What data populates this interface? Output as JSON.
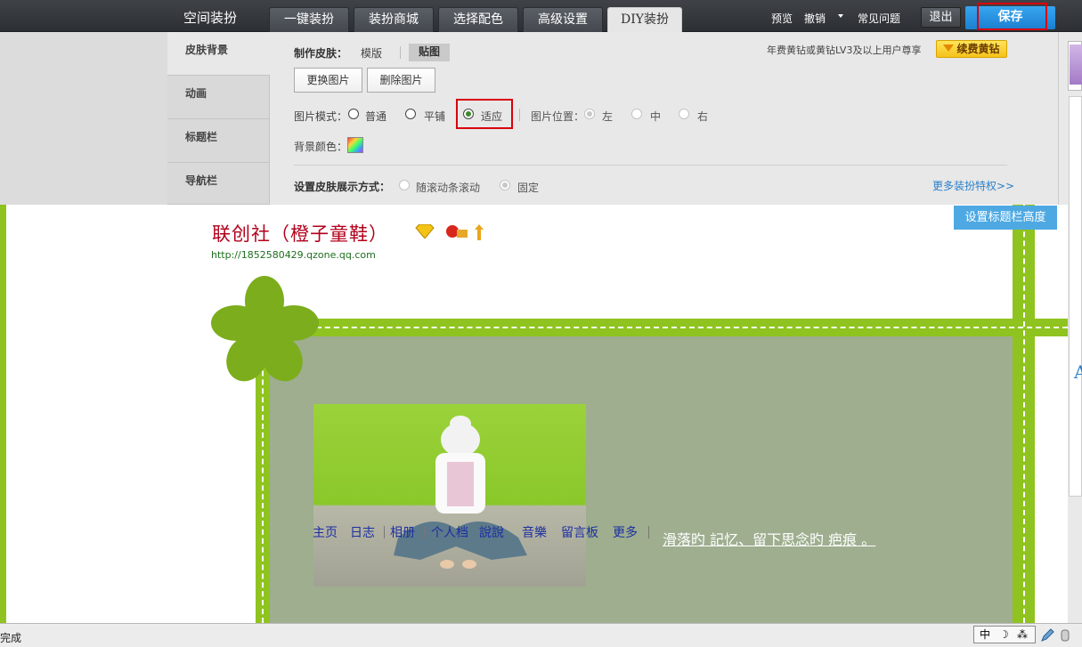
{
  "topbar": {
    "app_title": "空间装扮",
    "tabs": [
      {
        "label": "一键装扮"
      },
      {
        "label": "装扮商城"
      },
      {
        "label": "选择配色"
      },
      {
        "label": "高级设置"
      },
      {
        "label": "DIY装扮",
        "active": true
      }
    ],
    "links": {
      "preview": "预览",
      "undo": "撤销",
      "faq": "常见问题"
    },
    "exit_label": "退出",
    "save_label": "保存"
  },
  "sidebar": {
    "items": [
      {
        "label": "皮肤背景",
        "active": true
      },
      {
        "label": "动画"
      },
      {
        "label": "标题栏"
      },
      {
        "label": "导航栏"
      }
    ]
  },
  "panel": {
    "make_skin_label": "制作皮肤：",
    "template_label": "模版",
    "paste_label": "贴图",
    "vip_notice": "年费黄钻或黄钻LV3及以上用户尊享",
    "renew_label": "续费黄钻",
    "change_image_label": "更换图片",
    "delete_image_label": "删除图片",
    "image_mode_label": "图片模式：",
    "image_modes": [
      "普通",
      "平铺",
      "适应"
    ],
    "image_mode_selected": "适应",
    "image_position_label": "图片位置：",
    "image_positions": [
      "左",
      "中",
      "右"
    ],
    "bg_color_label": "背景颜色：",
    "display_mode_label": "设置皮肤展示方式：",
    "display_modes": [
      "随滚动条滚动",
      "固定"
    ],
    "display_mode_selected": "固定",
    "more_link": "更多装扮特权>>"
  },
  "preview": {
    "site_title": "联创社（橙子童鞋）",
    "site_url": "http://1852580429.qzone.qq.com",
    "set_height_button": "设置标题栏高度",
    "nav": [
      "主页",
      "日志",
      "相册",
      "个人档",
      "說說",
      "音樂",
      "留言板",
      "更多"
    ],
    "slogan": "滑落旳 記忆、留下思念旳 疤痕 。"
  },
  "statusbar": {
    "status_text": "完成",
    "ime_text": "中"
  },
  "colors": {
    "accent_green": "#8fc31f",
    "save_blue": "#1b7fd0",
    "highlight_red": "#d8000c",
    "title_red": "#b3001b"
  }
}
